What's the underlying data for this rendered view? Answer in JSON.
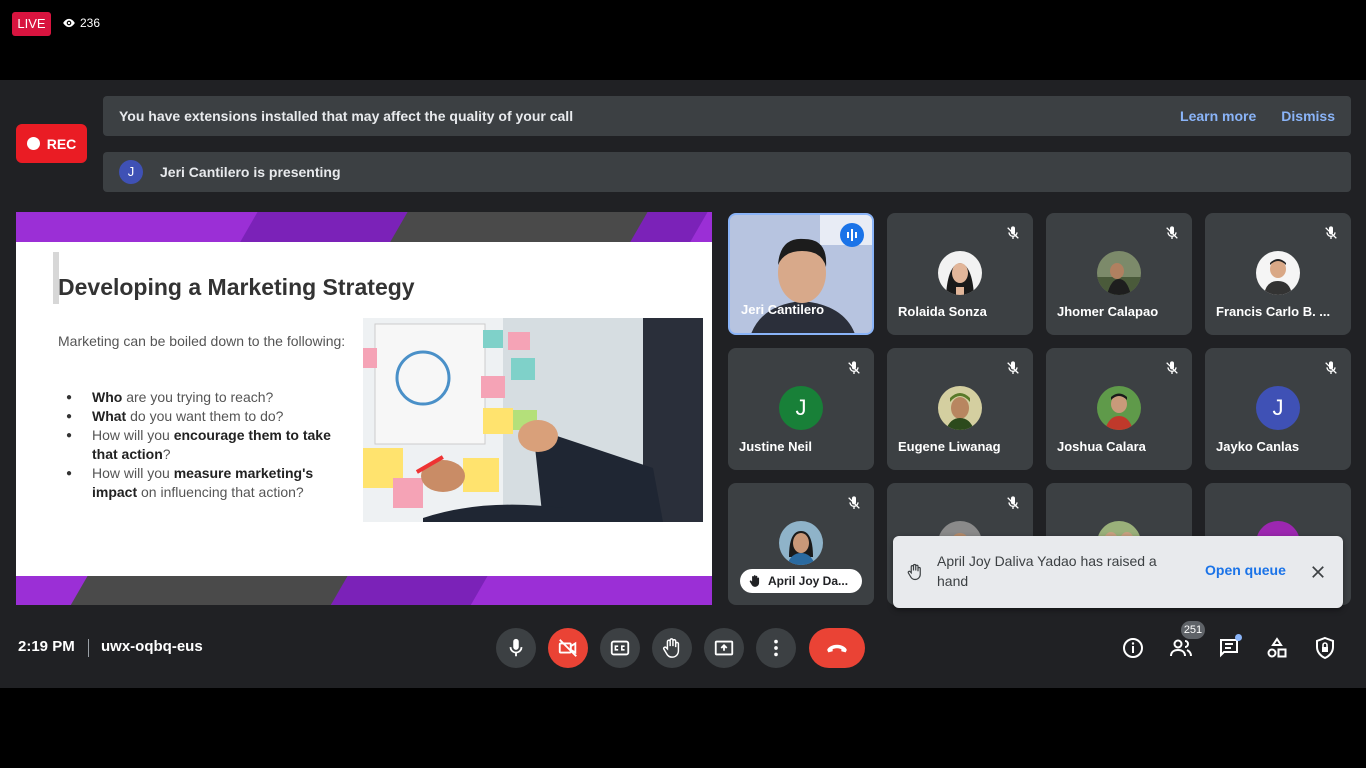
{
  "stream": {
    "live_label": "LIVE",
    "viewer_count": "236"
  },
  "recording": {
    "label": "REC"
  },
  "banners": {
    "extensions": {
      "message": "You have extensions installed that may affect the quality of your call",
      "learn_more": "Learn more",
      "dismiss": "Dismiss"
    },
    "presenting": {
      "avatar_letter": "J",
      "message": "Jeri Cantilero is presenting"
    }
  },
  "slide": {
    "title": "Developing a Marketing Strategy",
    "intro": "Marketing can be boiled down to the following:",
    "bullets": [
      {
        "bold": "Who",
        "rest": " are you trying to reach?"
      },
      {
        "bold": "What",
        "rest": " do you want them to do?"
      },
      {
        "pre": "How will you ",
        "bold": "encourage them to take that action",
        "rest": "?"
      },
      {
        "pre": "How will you ",
        "bold": "measure marketing's impact",
        "rest": " on influencing that action?"
      }
    ]
  },
  "participants": [
    {
      "name": "Jeri Cantilero",
      "speaking": true,
      "video": true
    },
    {
      "name": "Rolaida Sonza",
      "muted": true
    },
    {
      "name": "Jhomer Calapao",
      "muted": true
    },
    {
      "name": "Francis Carlo B. ...",
      "muted": true
    },
    {
      "name": "Justine Neil",
      "muted": true,
      "letter": "J",
      "color": "#188038"
    },
    {
      "name": "Eugene Liwanag",
      "muted": true
    },
    {
      "name": "Joshua Calara",
      "muted": true
    },
    {
      "name": "Jayko Canlas",
      "muted": true,
      "letter": "J",
      "color": "#3f51b5"
    },
    {
      "name": "April Joy Da...",
      "muted": true,
      "hand_raised": true
    }
  ],
  "toast": {
    "message": "April Joy Daliva Yadao has raised a hand",
    "action": "Open queue"
  },
  "meeting": {
    "time": "2:19 PM",
    "code": "uwx-oqbq-eus",
    "people_count": "251"
  },
  "colors": {
    "live": "#d8143f",
    "rec": "#ea1c24",
    "end_call": "#ea4335",
    "link": "#8ab4f8",
    "slide_accent": "#9b2fd6"
  }
}
